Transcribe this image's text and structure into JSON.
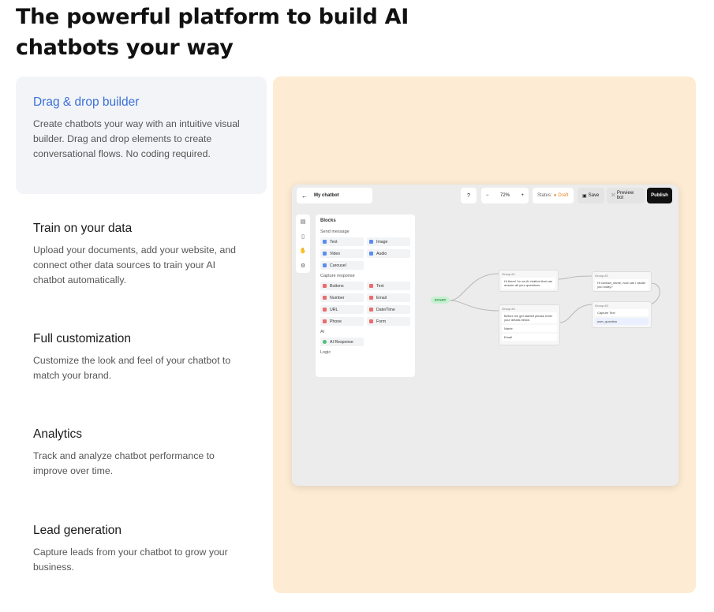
{
  "headline": "The powerful platform to build AI chatbots your way",
  "features": [
    {
      "title": "Drag & drop builder",
      "desc": "Create chatbots your way with an intuitive visual builder. Drag and drop elements to create conversational flows. No coding required.",
      "active": true
    },
    {
      "title": "Train on your data",
      "desc": "Upload your documents, add your website, and connect other data sources to train your AI chatbot automatically.",
      "active": false
    },
    {
      "title": "Full customization",
      "desc": "Customize the look and feel of your chatbot to match your brand.",
      "active": false
    },
    {
      "title": "Analytics",
      "desc": "Track and analyze chatbot performance to improve over time.",
      "active": false
    },
    {
      "title": "Lead generation",
      "desc": "Capture leads from your chatbot to grow your business.",
      "active": false
    }
  ],
  "colors": {
    "accent": "#3b6fd8",
    "panel_bg": "#fdebd3",
    "active_card_bg": "#f2f4f7",
    "draft": "#e88a2a"
  },
  "app": {
    "back_icon": "arrow-left-icon",
    "bot_name": "My chatbot",
    "help_icon": "help-circle-icon",
    "zoom_minus": "−",
    "zoom": "72%",
    "zoom_plus": "+",
    "status_label": "Status:",
    "status_value": "Draft",
    "save": "Save",
    "preview": "Preview bot",
    "publish": "Publish",
    "blocks": {
      "title": "Blocks",
      "send_message": {
        "title": "Send message",
        "items": [
          "Text",
          "Image",
          "Video",
          "Audio",
          "Carousel"
        ]
      },
      "capture_response": {
        "title": "Capture response",
        "items": [
          "Buttons",
          "Text",
          "Number",
          "Email",
          "URL",
          "Date/Time",
          "Phone",
          "Form"
        ]
      },
      "ai": {
        "title": "AI",
        "items": [
          "AI Response"
        ]
      },
      "logic": {
        "title": "Logic"
      }
    },
    "flow": {
      "start": "START",
      "group1": {
        "title": "Group #1",
        "text": "Hi there! I'm an AI chatbot that can answer all your questions."
      },
      "group2": {
        "title": "Group #2",
        "text": "Hi contact_name, how can I assist you today?"
      },
      "group3": {
        "title": "Group #3",
        "items": [
          "Capture Text",
          "user_question"
        ]
      },
      "group4": {
        "title": "Group #4",
        "text": "Before we get started please enter your details below.",
        "items": [
          "Name",
          "Email"
        ]
      }
    }
  }
}
